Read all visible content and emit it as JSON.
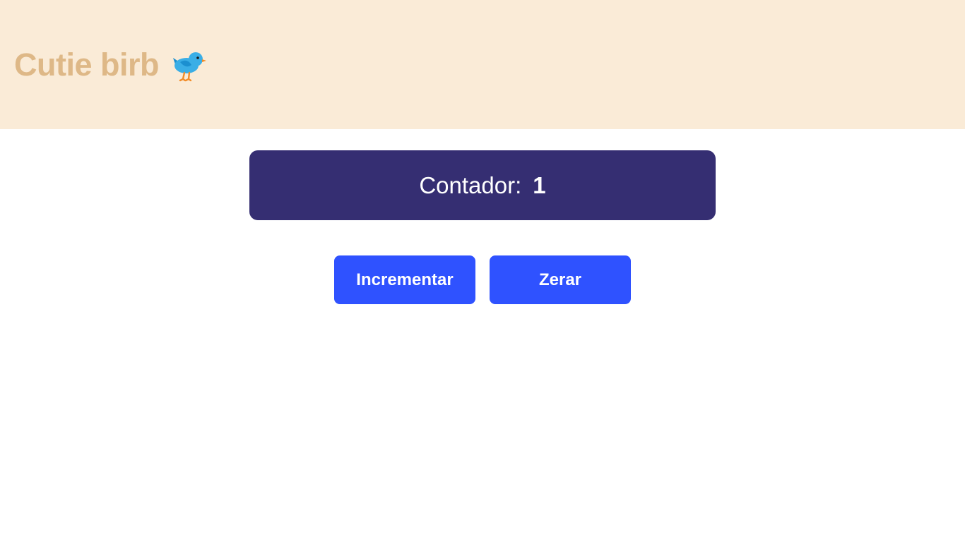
{
  "header": {
    "title": "Cutie birb",
    "icon": "bird-icon",
    "background_color": "#faebd7",
    "title_color": "#deb887"
  },
  "counter": {
    "label": "Contador:",
    "value": "1",
    "background_color": "#352e72"
  },
  "actions": {
    "increment_label": "Incrementar",
    "reset_label": "Zerar",
    "button_color": "#2f52ff"
  }
}
